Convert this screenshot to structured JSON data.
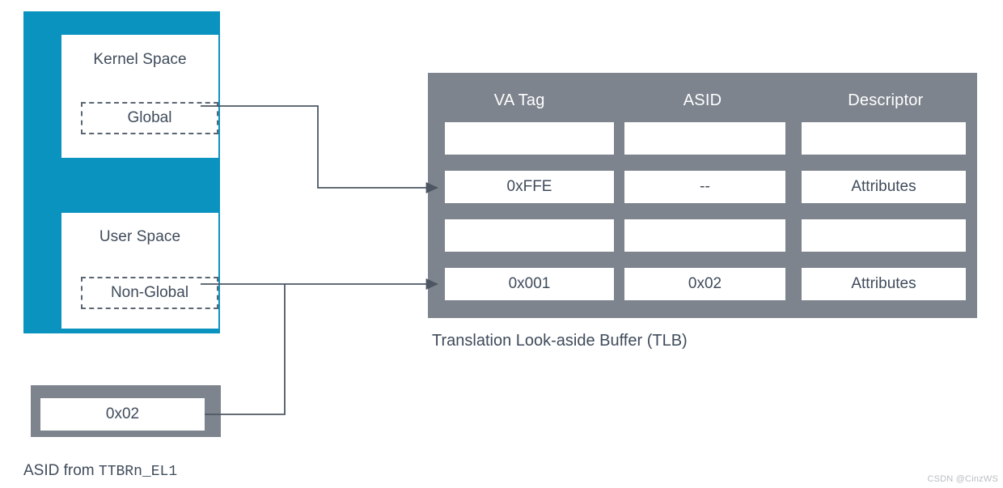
{
  "diagram": {
    "title": "ASID and TLB tagging diagram",
    "colors": {
      "accent_blue": "#0b93c0",
      "block_gray": "#7d848d",
      "text": "#3f4b5b",
      "line": "#4d5764",
      "white": "#ffffff",
      "watermark": "#b9bec4"
    }
  },
  "memory_block": {
    "kernel_space": {
      "label": "Kernel Space",
      "tag": "Global"
    },
    "user_space": {
      "label": "User Space",
      "tag": "Non-Global"
    }
  },
  "asid_register": {
    "value": "0x02",
    "caption_prefix": "ASID from ",
    "caption_register": "TTBRn_EL1"
  },
  "tlb": {
    "caption": "Translation Look-aside Buffer (TLB)",
    "columns": [
      "VA Tag",
      "ASID",
      "Descriptor"
    ],
    "rows": [
      {
        "va_tag": "",
        "asid": "",
        "descriptor": ""
      },
      {
        "va_tag": "0xFFE",
        "asid": "--",
        "descriptor": "Attributes"
      },
      {
        "va_tag": "",
        "asid": "",
        "descriptor": ""
      },
      {
        "va_tag": "0x001",
        "asid": "0x02",
        "descriptor": "Attributes"
      }
    ]
  },
  "watermark": {
    "text": "CSDN @CinzWS"
  }
}
